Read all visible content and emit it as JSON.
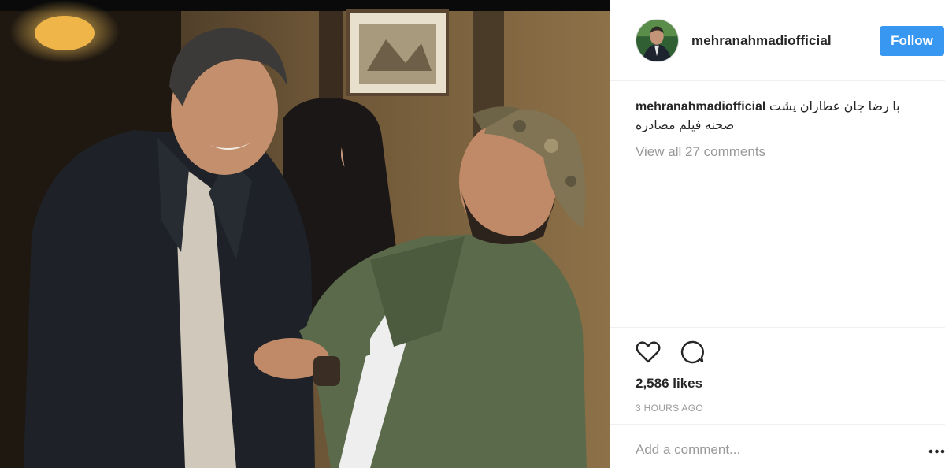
{
  "post": {
    "username": "mehranahmadiofficial",
    "follow_label": "Follow",
    "caption_user": "mehranahmadiofficial",
    "caption_line1": "با رضا جان عطاران پشت",
    "caption_line2": "صحنه فیلم مصادره",
    "view_comments": "View all 27 comments",
    "likes": "2,586 likes",
    "timestamp": "3 HOURS AGO",
    "comment_placeholder": "Add a comment..."
  },
  "icons": {
    "like": "heart-icon",
    "comment": "comment-icon",
    "more": "more-options-icon"
  },
  "colors": {
    "follow_button": "#3897f0",
    "muted_text": "#999999",
    "primary_text": "#262626"
  }
}
